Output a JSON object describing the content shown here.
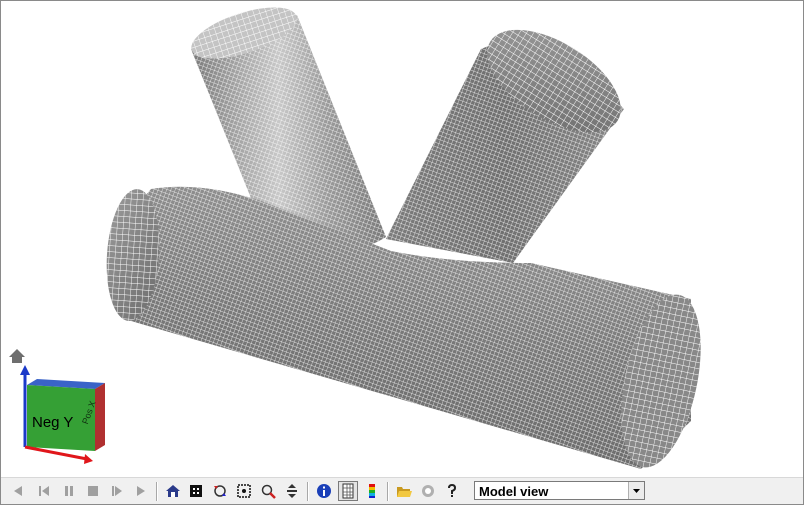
{
  "viewer": {
    "view_mode": "Model view",
    "view_mode_options": [
      "Model view"
    ],
    "nav_cube": {
      "front_label": "Neg Y",
      "side_label": "Pos X",
      "home_icon": "home-icon"
    },
    "axis_colors": {
      "x": "#e0161b",
      "y": "#1a7a1a",
      "z": "#1b39c9"
    }
  },
  "toolbar": {
    "playback_icons": [
      "prev-icon",
      "step-back-icon",
      "pause-icon",
      "stop-icon",
      "step-forward-icon",
      "next-icon"
    ],
    "view_icons": [
      "home-view-icon",
      "fit-icon",
      "rotate-icon",
      "center-icon",
      "zoom-icon",
      "pan-icon"
    ],
    "info_icons": [
      "info-icon",
      "mesh-icon",
      "color-legend-icon"
    ],
    "file_icons": [
      "open-folder-icon",
      "settings-icon",
      "help-icon"
    ]
  }
}
